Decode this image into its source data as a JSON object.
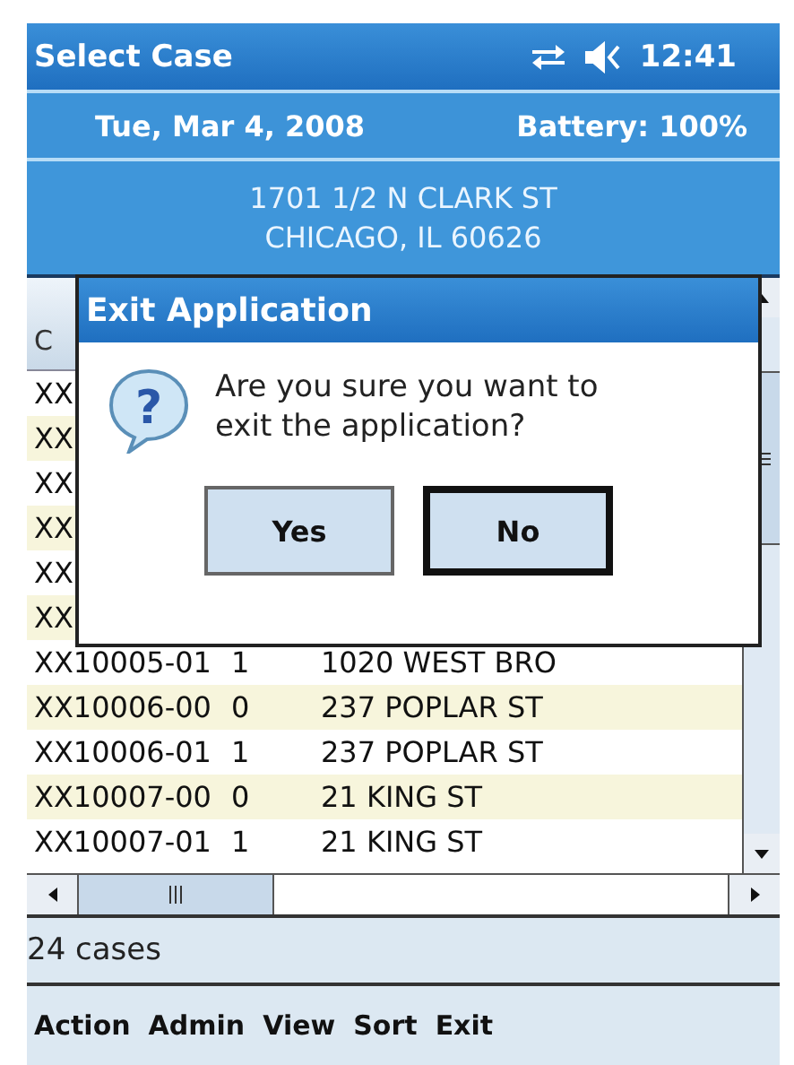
{
  "title_bar": {
    "title": "Select Case",
    "time": "12:41"
  },
  "info_bar": {
    "date": "Tue, Mar 4, 2008",
    "battery": "Battery: 100%"
  },
  "address": [
    "1701 1/2 N CLARK ST",
    "CHICAGO, IL 60626"
  ],
  "table": {
    "columns": [
      "C"
    ],
    "rows": [
      {
        "cells": [
          "XX"
        ]
      },
      {
        "cells": [
          "XX"
        ]
      },
      {
        "cells": [
          "XX"
        ]
      },
      {
        "cells": [
          "XX"
        ]
      },
      {
        "cells": [
          "XX"
        ]
      },
      {
        "cells": [
          "XX"
        ]
      },
      {
        "cells": [
          "XX10005-01",
          "1",
          "1020 WEST BRO"
        ]
      },
      {
        "cells": [
          "XX10006-00",
          "0",
          "237 POPLAR ST"
        ]
      },
      {
        "cells": [
          "XX10006-01",
          "1",
          "237 POPLAR ST"
        ]
      },
      {
        "cells": [
          "XX10007-00",
          "0",
          "21 KING ST"
        ]
      },
      {
        "cells": [
          "XX10007-01",
          "1",
          "21 KING ST"
        ]
      }
    ]
  },
  "status_bar": "24 cases",
  "menu": [
    "Action",
    "Admin",
    "View",
    "Sort",
    "Exit"
  ],
  "dialog": {
    "title": "Exit Application",
    "icon": "?",
    "message": "Are you sure you want to exit the application?",
    "buttons": [
      {
        "label": "Yes",
        "default": false
      },
      {
        "label": "No",
        "default": true
      }
    ]
  }
}
